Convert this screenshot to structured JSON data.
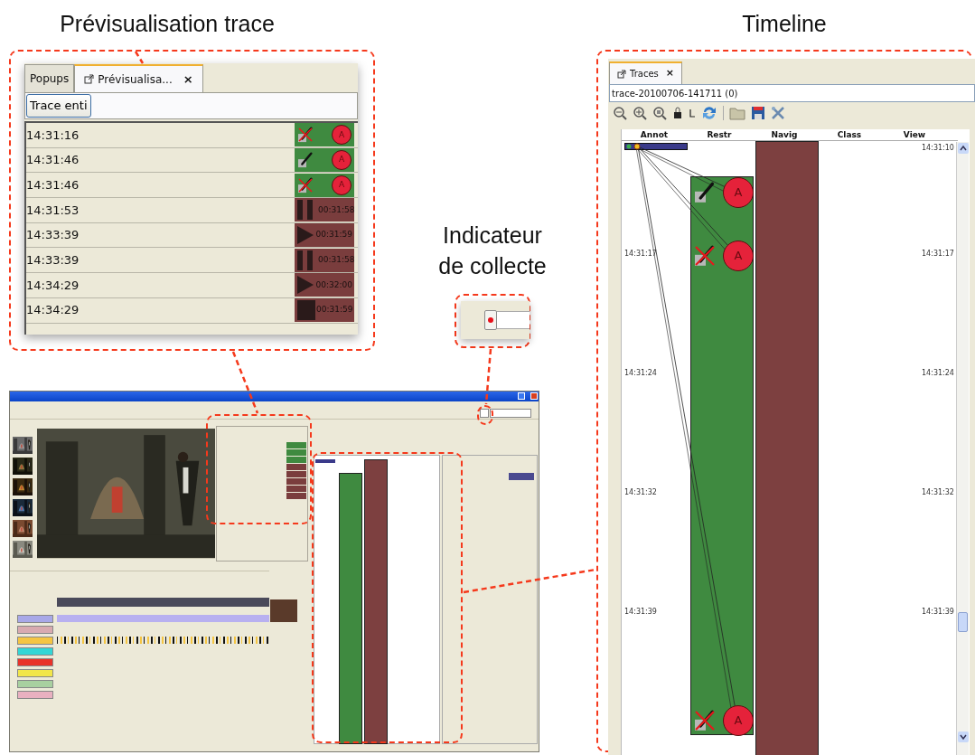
{
  "preview": {
    "heading": "Prévisualisation trace",
    "tabs": [
      {
        "label": "Popups",
        "selected": false
      },
      {
        "label": "Prévisualisa...",
        "selected": true,
        "close": "×"
      }
    ],
    "button": "Trace enti",
    "rows": [
      {
        "time": "14:31:16",
        "kind": "delete",
        "badge": "A"
      },
      {
        "time": "14:31:46",
        "kind": "edit",
        "badge": "A"
      },
      {
        "time": "14:31:46",
        "kind": "delete",
        "badge": "A"
      },
      {
        "time": "14:31:53",
        "kind": "pause",
        "reading": "00:31:58"
      },
      {
        "time": "14:33:39",
        "kind": "play",
        "reading": "00:31:59"
      },
      {
        "time": "14:33:39",
        "kind": "pause",
        "reading": "00:31:58"
      },
      {
        "time": "14:34:29",
        "kind": "play",
        "reading": "00:32:00"
      },
      {
        "time": "14:34:29",
        "kind": "stop",
        "reading": "00:31:59"
      }
    ]
  },
  "indicator": {
    "heading": [
      "Indicateur",
      "de collecte"
    ],
    "recording": true
  },
  "timeline": {
    "heading": "Timeline",
    "tab": {
      "label": "Traces",
      "selected": true,
      "close": "×"
    },
    "trace_field": "trace-20100706-141711 (0)",
    "columns": [
      "Annot",
      "Restr",
      "Navig",
      "Class",
      "View"
    ],
    "left_times": [
      "14:31:17",
      "14:31:24",
      "14:31:32",
      "14:31:39"
    ],
    "right_times": [
      "14:31:10",
      "14:31:17",
      "14:31:24",
      "14:31:32",
      "14:31:39"
    ],
    "events": [
      {
        "kind": "edit",
        "badge": "A"
      },
      {
        "kind": "delete",
        "badge": "A"
      },
      {
        "kind": "delete",
        "badge": "A"
      }
    ]
  },
  "mini_timeline": {
    "tracks": [
      {
        "color": "#a8a8e8"
      },
      {
        "color": "#d8aab0"
      },
      {
        "color": "#f5c542"
      },
      {
        "color": "#33d6d6"
      },
      {
        "color": "#e8322a"
      },
      {
        "color": "#f2e64a"
      },
      {
        "color": "#a8d0a0"
      },
      {
        "color": "#e8b0c0"
      }
    ]
  }
}
